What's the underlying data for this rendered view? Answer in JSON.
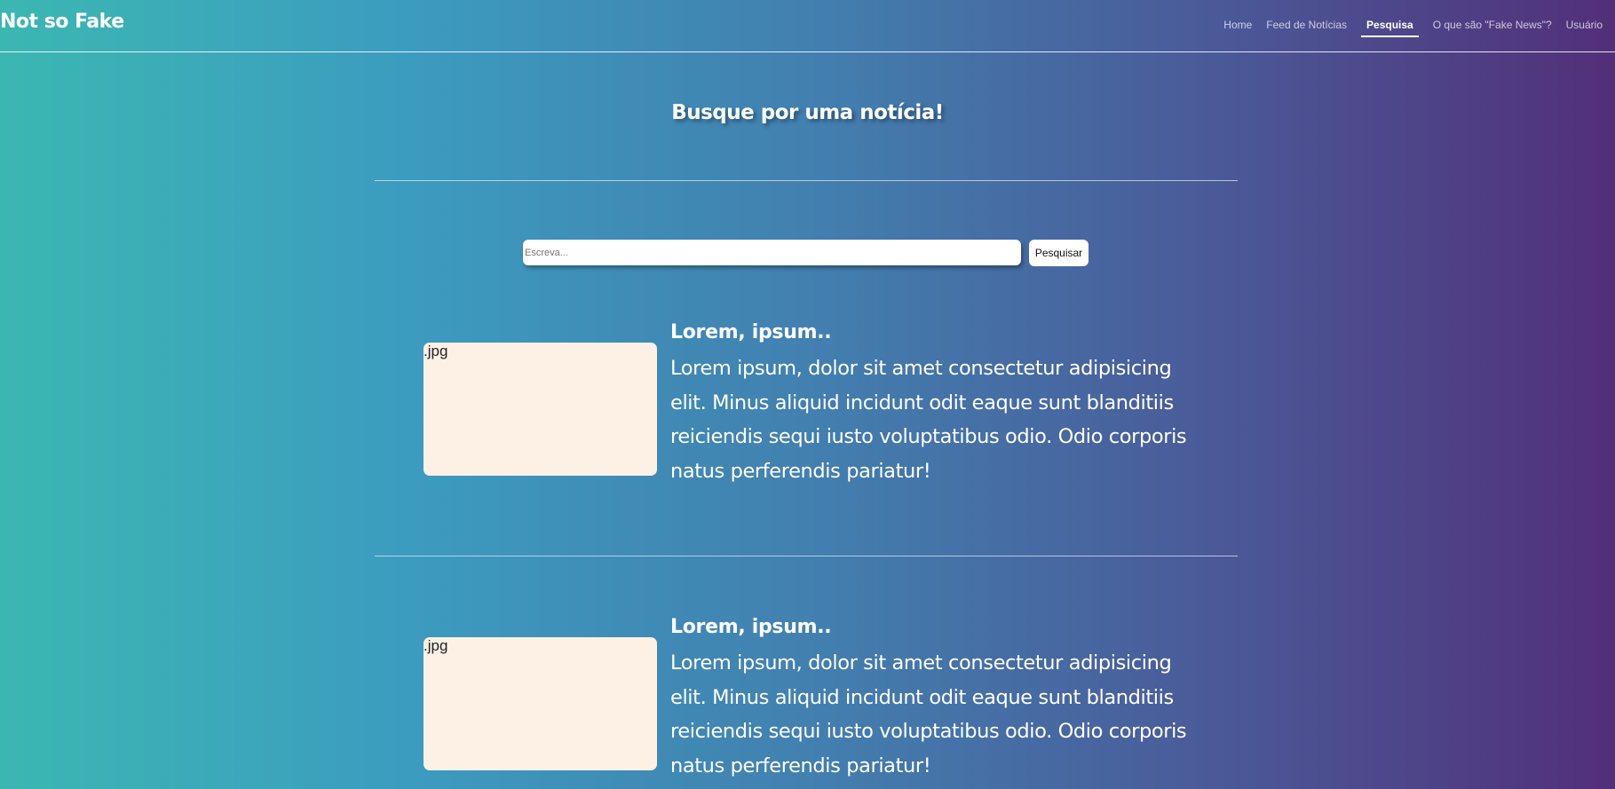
{
  "nav": {
    "brand": "Not so Fake",
    "links": [
      {
        "label": "Home",
        "active": false
      },
      {
        "label": "Feed de Notícias",
        "active": false
      },
      {
        "label": "Pesquisa",
        "active": true
      },
      {
        "label": "O que são \"Fake News\"?",
        "active": false
      },
      {
        "label": "Usuário",
        "active": false
      }
    ]
  },
  "search": {
    "title": "Busque por uma notícia!",
    "placeholder": "Escreva...",
    "value": "",
    "button_label": "Pesquisar"
  },
  "articles": [
    {
      "image_label": ".jpg",
      "title": "Lorem, ipsum..",
      "body": "Lorem ipsum, dolor sit amet consectetur adipisicing elit. Minus aliquid incidunt odit eaque sunt blanditiis reiciendis sequi iusto voluptatibus odio. Odio corporis natus perferendis pariatur!"
    },
    {
      "image_label": ".jpg",
      "title": "Lorem, ipsum..",
      "body": "Lorem ipsum, dolor sit amet consectetur adipisicing elit. Minus aliquid incidunt odit eaque sunt blanditiis reiciendis sequi iusto voluptatibus odio. Odio corporis natus perferendis pariatur!"
    }
  ],
  "colors": {
    "gradient_start": "#3bb7b2",
    "gradient_end": "#522f78",
    "thumbnail_bg": "#fdf1e6"
  }
}
